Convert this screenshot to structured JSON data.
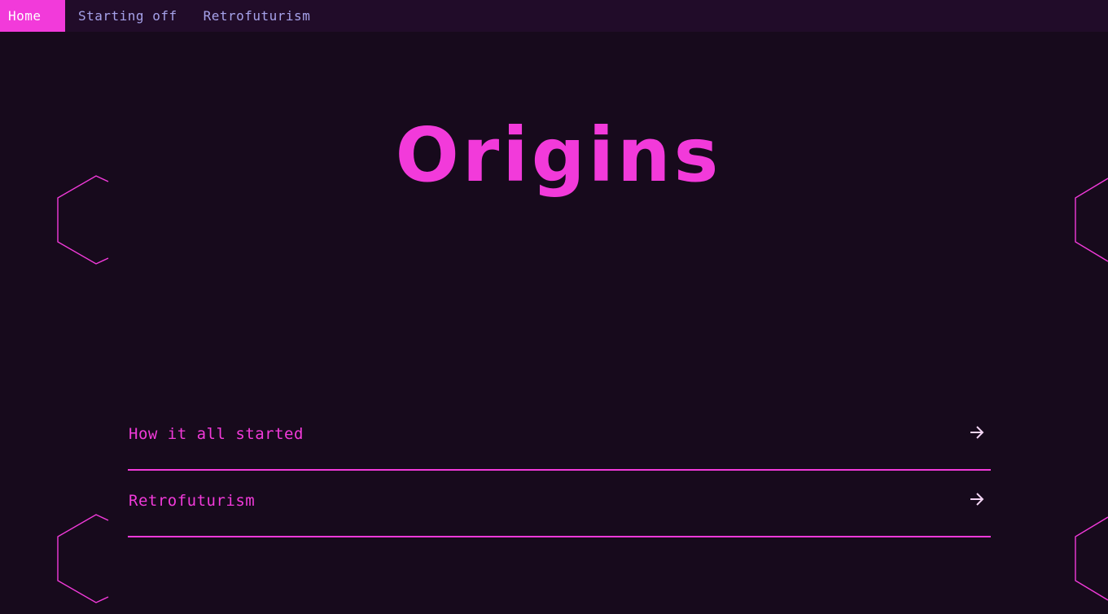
{
  "nav": {
    "items": [
      {
        "label": "Home",
        "active": true
      },
      {
        "label": "Starting off",
        "active": false
      },
      {
        "label": "Retrofuturism",
        "active": false
      }
    ]
  },
  "hero": {
    "title": "Origins"
  },
  "links": [
    {
      "label": "How it all started",
      "icon": "arrow-right-icon"
    },
    {
      "label": "Retrofuturism",
      "icon": "arrow-right-icon"
    }
  ],
  "colors": {
    "background": "#170a1c",
    "nav_background": "#210c29",
    "accent": "#f23ada",
    "nav_text": "#a6a2ea",
    "arrow": "#f4d6f5"
  }
}
